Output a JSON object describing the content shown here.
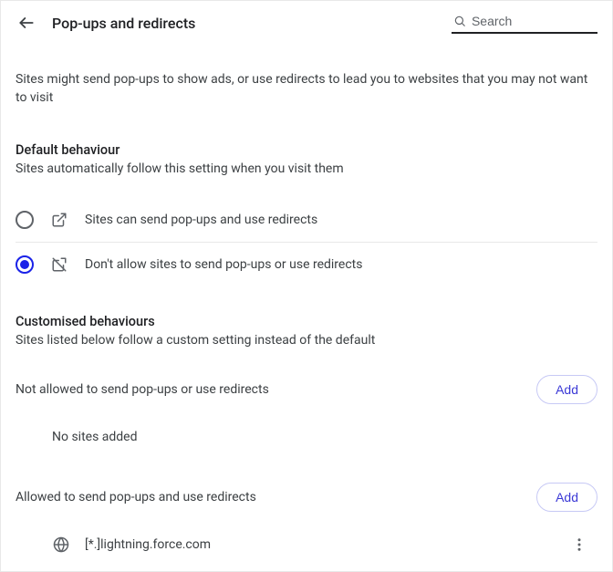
{
  "header": {
    "title": "Pop-ups and redirects",
    "search_placeholder": "Search"
  },
  "intro": "Sites might send pop-ups to show ads, or use redirects to lead you to websites that you may not want to visit",
  "default_section": {
    "title": "Default behaviour",
    "sub": "Sites automatically follow this setting when you visit them",
    "options": [
      {
        "label": "Sites can send pop-ups and use redirects",
        "selected": false
      },
      {
        "label": "Don't allow sites to send pop-ups or use redirects",
        "selected": true
      }
    ]
  },
  "custom_section": {
    "title": "Customised behaviours",
    "sub": "Sites listed below follow a custom setting instead of the default"
  },
  "blocked": {
    "title": "Not allowed to send pop-ups or use redirects",
    "add_label": "Add",
    "empty": "No sites added"
  },
  "allowed": {
    "title": "Allowed to send pop-ups and use redirects",
    "add_label": "Add",
    "sites": [
      {
        "pattern": "[*.]lightning.force.com"
      }
    ]
  }
}
